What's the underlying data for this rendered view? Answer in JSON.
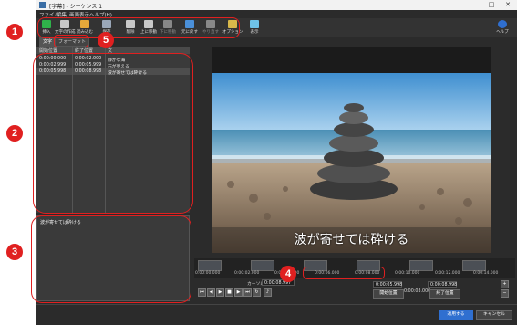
{
  "window": {
    "title": "[字幕] - シーケンス 1",
    "controls": [
      "–",
      "□",
      "✕"
    ]
  },
  "menu": [
    "ファイル",
    "編集",
    "画面表示",
    "ヘルプ(H)"
  ],
  "toolbar": {
    "items": [
      {
        "label": "挿入",
        "icon": "plus-icon",
        "color": "#2fb24a"
      },
      {
        "label": "文字の作成",
        "icon": "text-create-icon",
        "color": "#c8c8c8"
      },
      {
        "label": "読み込む",
        "icon": "folder-import-icon",
        "color": "#e5a93a"
      },
      {
        "label": "保存",
        "icon": "save-icon",
        "color": "#9aa7b8"
      },
      {
        "label": "削除",
        "icon": "delete-icon",
        "color": "#c8c8c8"
      },
      {
        "label": "上に移動",
        "icon": "move-up-icon",
        "color": "#c8c8c8"
      },
      {
        "label": "下に移動",
        "icon": "move-down-icon",
        "color": "#888888"
      },
      {
        "label": "元に戻す",
        "icon": "undo-icon",
        "color": "#4a8fd8"
      },
      {
        "label": "やり直す",
        "icon": "redo-icon",
        "color": "#888888"
      },
      {
        "label": "オプション",
        "icon": "wrench-icon",
        "color": "#d8b84a"
      },
      {
        "label": "表示",
        "icon": "eye-icon",
        "color": "#6fc3e8"
      }
    ],
    "help_label": "ヘルプ"
  },
  "tabs": [
    "文字",
    "フォーマット"
  ],
  "list": {
    "headers": [
      "開始位置",
      "終了位置",
      "文"
    ],
    "rows": [
      {
        "start": "0:00:00.000",
        "end": "0:00:02.000",
        "text": "静かな海"
      },
      {
        "start": "0:00:02.999",
        "end": "0:00:05.999",
        "text": "石が見える"
      },
      {
        "start": "0:00:05.998",
        "end": "0:00:08.998",
        "text": "波が寄せては砕ける"
      }
    ]
  },
  "editor": {
    "text": "波が寄せては砕ける"
  },
  "preview": {
    "subtitle": "波が寄せては砕ける"
  },
  "timeline": {
    "ticks": [
      "0:00:00.000",
      "0:00:02.000",
      "0:00:04.000",
      "0:00:06.000",
      "0:00:08.000",
      "0:00:10.000",
      "0:00:12.000",
      "0:00:14.000"
    ]
  },
  "controls": {
    "cursor_label": "カーソル",
    "cursor_value": "0:00:08.997",
    "start_value": "0:00:05.998",
    "end_value": "0:00:08.998",
    "duration_value": "0:00:03.000",
    "start_button": "開始位置",
    "end_button": "終了位置"
  },
  "footer": {
    "apply_label": "適用する",
    "cancel_label": "キャンセル"
  },
  "annotations": [
    "1",
    "2",
    "3",
    "4",
    "5"
  ],
  "colors": {
    "annotation_red": "#e02020",
    "timeline_clip": "#4f3fd6",
    "apply_blue": "#2f6fd0"
  }
}
